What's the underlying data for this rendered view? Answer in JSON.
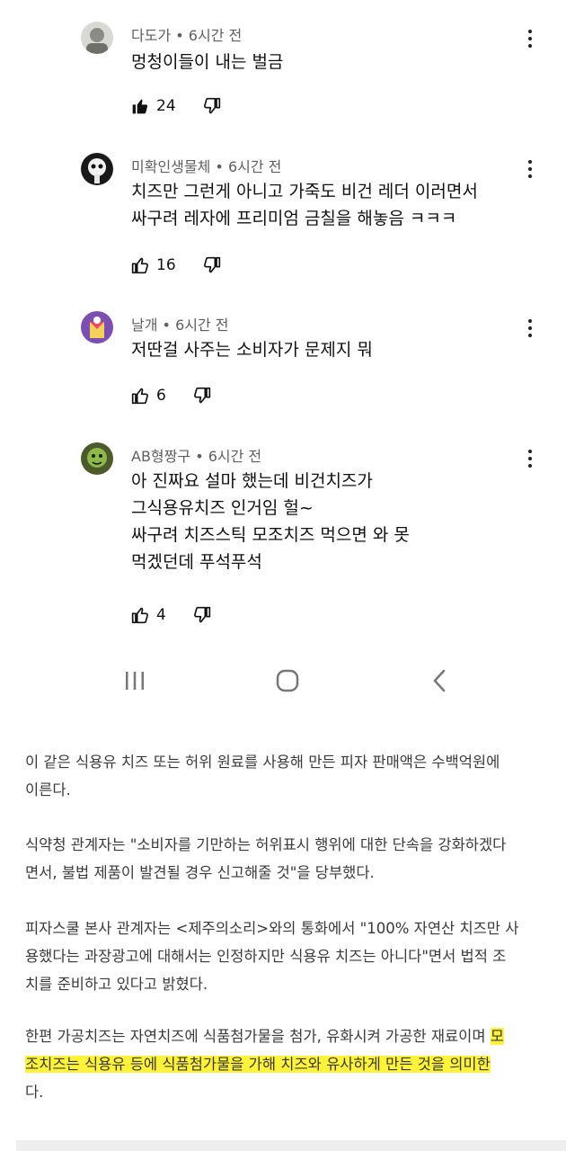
{
  "comments": [
    {
      "author": "다도가",
      "time": "6시간 전",
      "lines": [
        "멍청이들이 내는 벌금"
      ],
      "likes": "24",
      "liked": true
    },
    {
      "author": "미확인생물체",
      "time": "6시간 전",
      "lines": [
        "치즈만 그런게 아니고 가죽도 비건 레더 이러면서",
        "싸구려 레자에 프리미엄 금칠을 해놓음 ㅋㅋㅋ"
      ],
      "likes": "16",
      "liked": false
    },
    {
      "author": "날개",
      "time": "6시간 전",
      "lines": [
        "저딴걸 사주는 소비자가 문제지 뭐"
      ],
      "likes": "6",
      "liked": false
    },
    {
      "author": "AB형짱구",
      "time": "6시간 전",
      "lines": [
        "아 진짜요 설마  했는데  비건치즈가",
        "그식용유치즈 인거임  헐~",
        "싸구려 치즈스틱  모조치즈 먹으면 와 못",
        "먹겠던데 푸석푸석"
      ],
      "likes": "4",
      "liked": false
    }
  ],
  "meta_separator": "•",
  "navbar": {
    "icons": [
      "recent-apps-icon",
      "home-icon",
      "back-icon"
    ]
  },
  "article": {
    "paragraphs": [
      [
        "이 같은 식용유 치즈 또는 허위 원료를 사용해 만든 피자 판매액은 수백억원에",
        "이른다."
      ],
      [
        "식약청 관계자는 \"소비자를 기만하는 허위표시 행위에 대한 단속을 강화하겠다",
        "면서, 불법 제품이 발견될 경우 신고해줄 것\"을 당부했다."
      ],
      [
        "피자스쿨 본사 관계자는 <제주의소리>와의 통화에서 \"100% 자연산 치즈만 사",
        "용했다는 과장광고에 대해서는 인정하지만 식용유 치즈는 아니다\"면서 법적 조",
        "치를 준비하고 있다고 밝혔다."
      ]
    ],
    "last_paragraph": {
      "line1_plain": "한편 가공치즈는 자연치즈에 식품첨가물을 첨가, 유화시켜 가공한 재료이며 ",
      "line1_highlight": "모",
      "line2_highlight": "조치즈는 식용유 등에 식품첨가물을 가해 치즈와 유사하게 만든 것을 의미한",
      "line3": "다."
    },
    "highlight_color": "#fff23a"
  }
}
